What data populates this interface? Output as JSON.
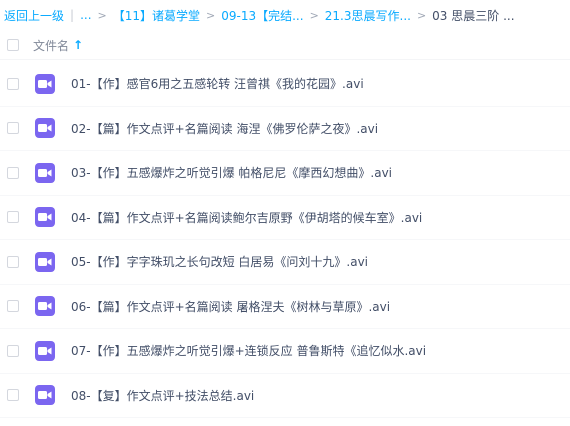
{
  "breadcrumb": {
    "back": "返回上一级",
    "ellipsis": "...",
    "items": [
      "【11】诸葛学堂",
      "09-13【完结...",
      "21.3思晨写作...",
      "03 思晨三阶 ..."
    ]
  },
  "header": {
    "column_name": "文件名",
    "sort_arrow": "↑"
  },
  "files": [
    {
      "name": "01-【作】感官6用之五感轮转 汪曾祺《我的花园》.avi"
    },
    {
      "name": "02-【篇】作文点评+名篇阅读 海涅《佛罗伦萨之夜》.avi"
    },
    {
      "name": "03-【作】五感爆炸之听觉引爆 帕格尼尼《摩西幻想曲》.avi"
    },
    {
      "name": "04-【篇】作文点评+名篇阅读鲍尔吉原野《伊胡塔的候车室》.avi"
    },
    {
      "name": "05-【作】字字珠玑之长句改短 白居易《问刘十九》.avi"
    },
    {
      "name": "06-【篇】作文点评+名篇阅读 屠格涅夫《树林与草原》.avi"
    },
    {
      "name": "07-【作】五感爆炸之听觉引爆+连锁反应 普鲁斯特《追忆似水.avi"
    },
    {
      "name": "08-【复】作文点评+技法总结.avi"
    }
  ],
  "colors": {
    "link": "#09aaff",
    "video_icon": "#7b66f0"
  },
  "icons": {
    "file": "video-file-icon"
  }
}
